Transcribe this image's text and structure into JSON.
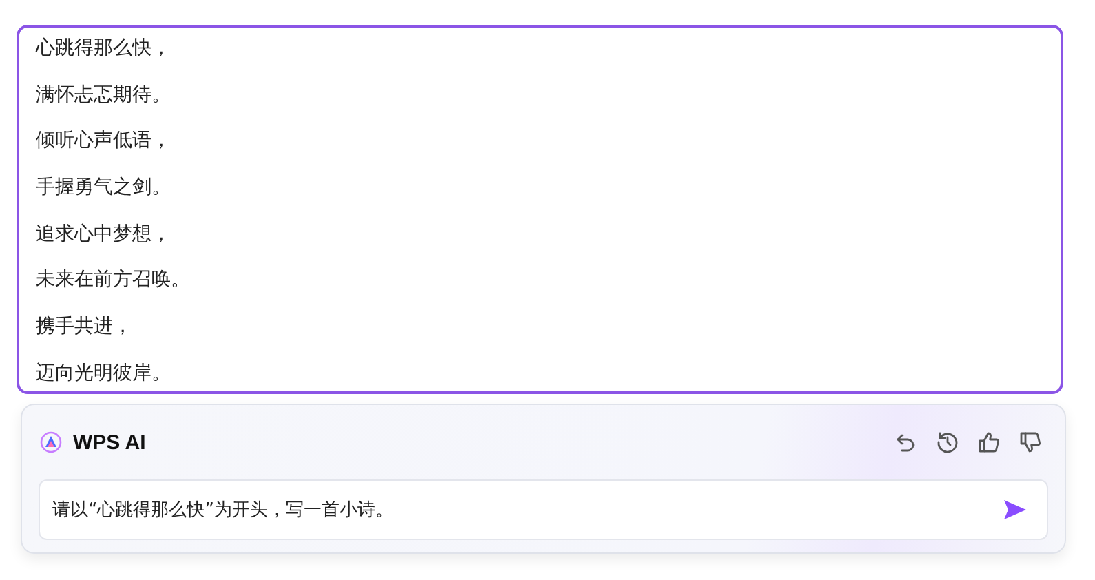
{
  "poem_lines": [
    "心跳得那么快，",
    "满怀忐忑期待。",
    "倾听心声低语，",
    "手握勇气之剑。",
    "追求心中梦想，",
    "未来在前方召唤。",
    "携手共进，",
    "迈向光明彼岸。"
  ],
  "ai_panel": {
    "title": "WPS AI",
    "prompt": {
      "value": "请以“心跳得那么快”为开头，写一首小诗。"
    }
  }
}
